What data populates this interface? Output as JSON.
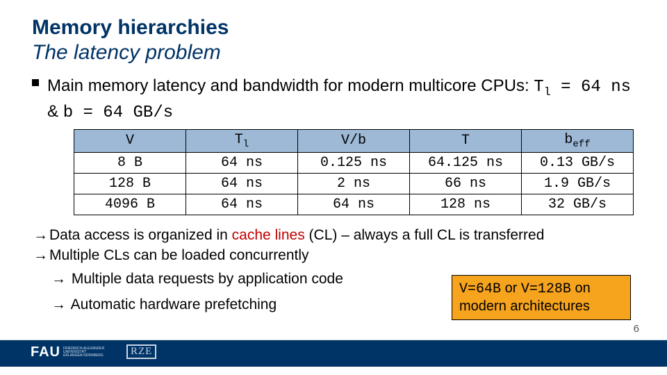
{
  "title": {
    "line1": "Memory hierarchies",
    "line2": "The latency problem"
  },
  "bullet1": {
    "pre": "Main memory latency and bandwidth for modern multicore CPUs: ",
    "tl_label": "T",
    "tl_sub": "l",
    "eq1": " = 64 ns",
    "amp": " & ",
    "eq2_lhs": "b",
    "eq2": " = 64 GB/s"
  },
  "chart_data": {
    "type": "table",
    "headers": {
      "c0": "V",
      "c1_main": "T",
      "c1_sub": "l",
      "c2": "V/b",
      "c3": "T",
      "c4_main": "b",
      "c4_sub": "eff"
    },
    "rows": [
      {
        "V": "8 B",
        "Tl": "64 ns",
        "Vb": "0.125 ns",
        "T": "64.125 ns",
        "beff": "0.13 GB/s"
      },
      {
        "V": "128 B",
        "Tl": "64 ns",
        "Vb": "2 ns",
        "T": "66 ns",
        "beff": "1.9 GB/s"
      },
      {
        "V": "4096 B",
        "Tl": "64 ns",
        "Vb": "64 ns",
        "T": "128 ns",
        "beff": "32 GB/s"
      }
    ]
  },
  "lines": {
    "l1a": "Data access is organized in ",
    "l1b": "cache lines",
    "l1c": " (CL) – always a full CL is transferred",
    "l2": "Multiple CLs can be loaded concurrently",
    "s1": " Multiple data requests by application code",
    "s2": " Automatic hardware prefetching"
  },
  "callout": {
    "a": "V=64B",
    "or": " or ",
    "b": "V=128B",
    "tail": " on modern architectures"
  },
  "footer": {
    "brand": "FAU",
    "brand_sub1": "FRIEDRICH-ALEXANDER",
    "brand_sub2": "UNIVERSITÄT",
    "brand_sub3": "ERLANGEN-NÜRNBERG",
    "logo2": "RZE",
    "page": "6"
  }
}
